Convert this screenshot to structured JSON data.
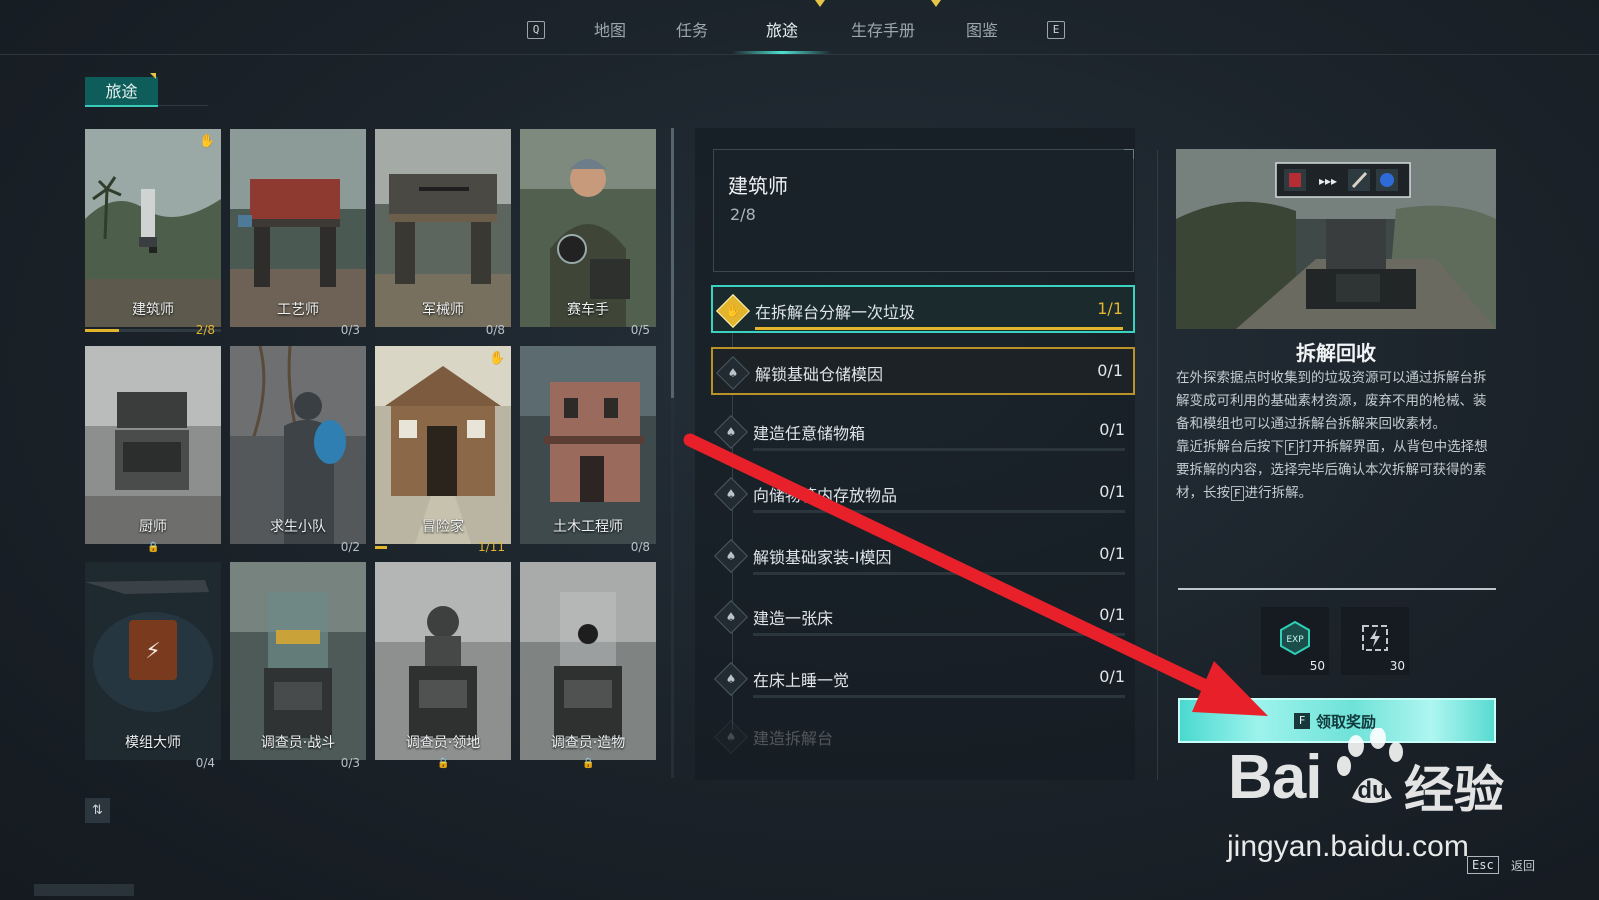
{
  "nav": {
    "key_left": "Q",
    "key_right": "E",
    "tabs": [
      "地图",
      "任务",
      "旅途",
      "生存手册",
      "图鉴"
    ],
    "active": "旅途"
  },
  "section": {
    "title": "旅途"
  },
  "journeys": [
    {
      "title": "建筑师",
      "progress": "2/8",
      "fraction": 0.25,
      "selected": true,
      "badge": true,
      "status": "progress"
    },
    {
      "title": "工艺师",
      "progress": "0/3",
      "fraction": 0,
      "status": "progress"
    },
    {
      "title": "军械师",
      "progress": "0/8",
      "fraction": 0,
      "status": "progress"
    },
    {
      "title": "赛车手",
      "progress": "0/5",
      "fraction": 0,
      "status": "progress"
    },
    {
      "title": "厨师",
      "progress": "",
      "status": "locked"
    },
    {
      "title": "求生小队",
      "progress": "0/2",
      "fraction": 0,
      "status": "progress"
    },
    {
      "title": "冒险家",
      "progress": "1/11",
      "fraction": 0.09,
      "badge": true,
      "gold": true,
      "status": "progress"
    },
    {
      "title": "土木工程师",
      "progress": "0/8",
      "fraction": 0,
      "status": "progress"
    },
    {
      "title": "模组大师",
      "progress": "0/4",
      "fraction": 0,
      "status": "progress"
    },
    {
      "title": "调查员·战斗",
      "progress": "0/3",
      "fraction": 0,
      "status": "progress"
    },
    {
      "title": "调查员·领地",
      "progress": "",
      "status": "locked"
    },
    {
      "title": "调查员·造物",
      "progress": "",
      "status": "locked"
    }
  ],
  "selected_journey": {
    "name": "建筑师",
    "progress": "2/8"
  },
  "tasks": [
    {
      "label": "在拆解台分解一次垃圾",
      "progress": "1/1",
      "state": "active"
    },
    {
      "label": "解锁基础仓储模因",
      "progress": "0/1",
      "state": "claimable"
    },
    {
      "label": "建造任意储物箱",
      "progress": "0/1",
      "state": "normal"
    },
    {
      "label": "向储物箱内存放物品",
      "progress": "0/1",
      "state": "normal"
    },
    {
      "label": "解锁基础家装-I模因",
      "progress": "0/1",
      "state": "normal"
    },
    {
      "label": "建造一张床",
      "progress": "0/1",
      "state": "normal"
    },
    {
      "label": "在床上睡一觉",
      "progress": "0/1",
      "state": "normal"
    },
    {
      "label": "建造拆解台",
      "progress": "",
      "state": "faded"
    }
  ],
  "detail": {
    "title": "拆解回收",
    "para1": "在外探索据点时收集到的垃圾资源可以通过拆解台拆解变成可利用的基础素材资源，废弃不用的枪械、装备和模组也可以通过拆解台拆解来回收素材。",
    "para2_a": "靠近拆解台后按下",
    "para2_key": "F",
    "para2_b": "打开拆解界面，从背包中选择想要拆解的内容，选择完毕后确认本次拆解可获得的素材，长按",
    "para2_key2": "F",
    "para2_c": "进行拆解。",
    "rewards": [
      {
        "icon": "exp-icon",
        "qty": "50"
      },
      {
        "icon": "reward-token-icon",
        "qty": "30"
      }
    ],
    "claim": {
      "key": "F",
      "label": "领取奖励"
    }
  },
  "footer": {
    "esc_key": "Esc",
    "esc_label": "返回"
  },
  "watermark": {
    "brand": "Bai",
    "cn": "经验",
    "url": "jingyan.baidu.com"
  },
  "colors": {
    "accent": "#39d3bf",
    "gold": "#e3b52d",
    "annotation_arrow": "#e8202a"
  }
}
